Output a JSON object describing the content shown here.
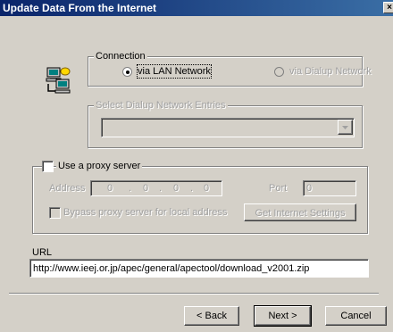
{
  "window": {
    "title": "Update Data From the Internet",
    "close_glyph": "×"
  },
  "connection": {
    "legend": "Connection",
    "lan_label": "via LAN Network",
    "dialup_label": "via Dialup Network",
    "selected": "lan"
  },
  "dialup_entries": {
    "legend": "Select Dialup Network Entries",
    "value": ""
  },
  "proxy": {
    "checkbox_label": "Use a proxy server",
    "checked": false,
    "address_label": "Address",
    "address_octets": [
      "0",
      "0",
      "0",
      "0"
    ],
    "port_label": "Port",
    "port_value": "0",
    "bypass_label": "Bypass proxy server for local address",
    "get_settings_label": "Get Internet Settings"
  },
  "url": {
    "label": "URL",
    "value": "http://www.ieej.or.jp/apec/general/apectool/download_v2001.zip"
  },
  "buttons": {
    "back": "< Back",
    "next": "Next >",
    "cancel": "Cancel"
  },
  "colors": {
    "face": "#d4d0c8",
    "title_start": "#0a246a",
    "title_end": "#3a6ea5",
    "disabled_text": "#a0a0a0"
  },
  "icons": {
    "network": "network-computers-icon",
    "dropdown": "chevron-down-icon"
  }
}
